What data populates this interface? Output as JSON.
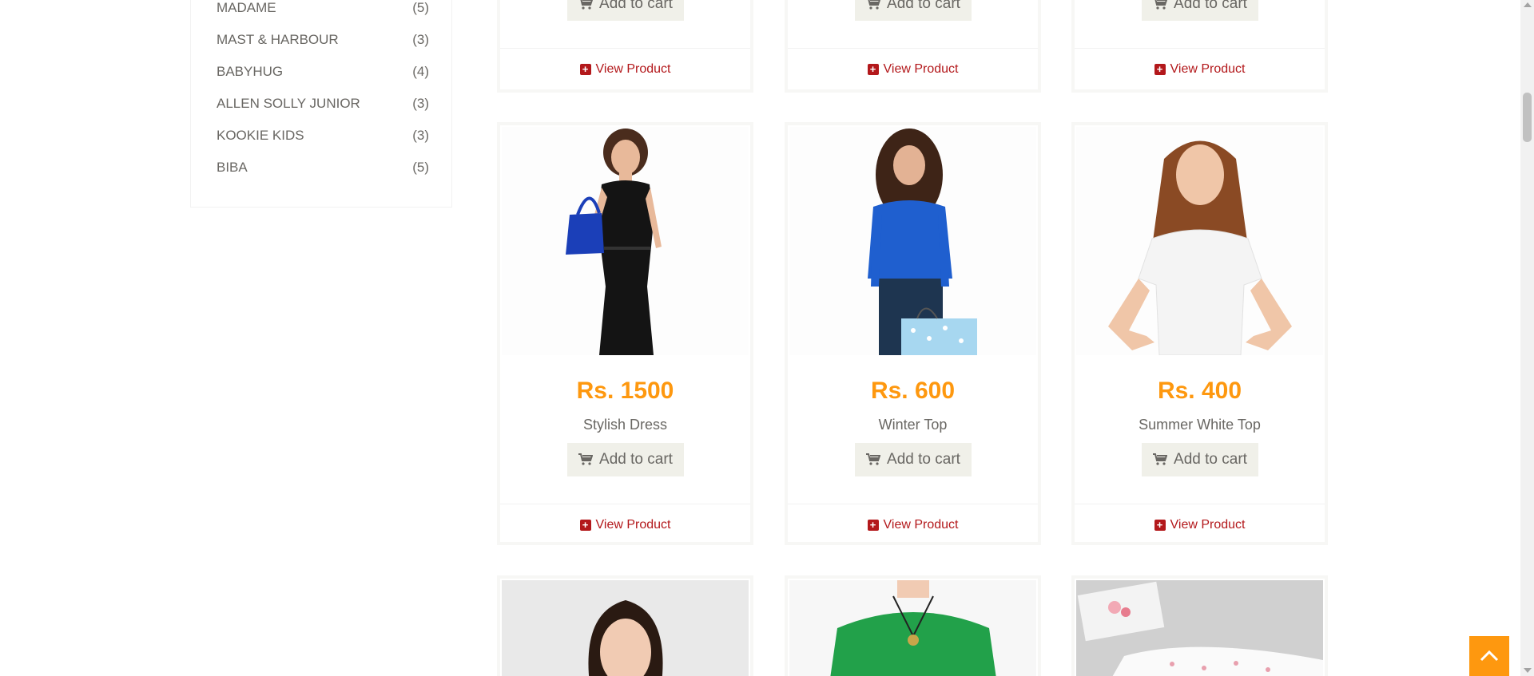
{
  "brands": [
    {
      "name": "MADAME",
      "count": "(5)"
    },
    {
      "name": "MAST & HARBOUR",
      "count": "(3)"
    },
    {
      "name": "BABYHUG",
      "count": "(4)"
    },
    {
      "name": "ALLEN SOLLY JUNIOR",
      "count": "(3)"
    },
    {
      "name": "KOOKIE KIDS",
      "count": "(3)"
    },
    {
      "name": "BIBA",
      "count": "(5)"
    }
  ],
  "top_row": {
    "add_to_cart": "Add to cart",
    "view_product": "View Product"
  },
  "products": [
    {
      "price": "Rs. 1500",
      "name": "Stylish Dress",
      "add_to_cart": "Add to cart",
      "view_product": "View Product"
    },
    {
      "price": "Rs. 600",
      "name": "Winter Top",
      "add_to_cart": "Add to cart",
      "view_product": "View Product"
    },
    {
      "price": "Rs. 400",
      "name": "Summer White Top",
      "add_to_cart": "Add to cart",
      "view_product": "View Product"
    }
  ],
  "colors": {
    "price": "#fe980f",
    "view_product": "#b3181b",
    "button_bg": "#f0f0e9",
    "back_to_top": "#fe980f"
  }
}
